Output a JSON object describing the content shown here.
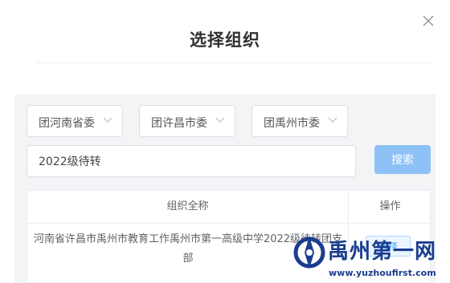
{
  "dialog": {
    "title": "选择组织"
  },
  "filters": {
    "province": "团河南省委",
    "city": "团许昌市委",
    "county": "团禹州市委"
  },
  "search": {
    "value": "2022级待转",
    "button_label": "搜索"
  },
  "table": {
    "columns": [
      "组织全称",
      "操作"
    ],
    "rows": [
      {
        "name": "河南省许昌市禹州市教育工作禹州市第一高级中学2022级待转团支部",
        "action": "选择"
      }
    ]
  },
  "watermark": {
    "title": "禹州第一网",
    "url": "www.yuzhoufirst.com"
  },
  "colors": {
    "primary_button": "#8ec1f5",
    "panel_bg": "#f3f4f6",
    "watermark_blue": "#1a3d8f"
  },
  "icons": {
    "close": "close-icon",
    "dropdown": "chevron-down-icon"
  }
}
